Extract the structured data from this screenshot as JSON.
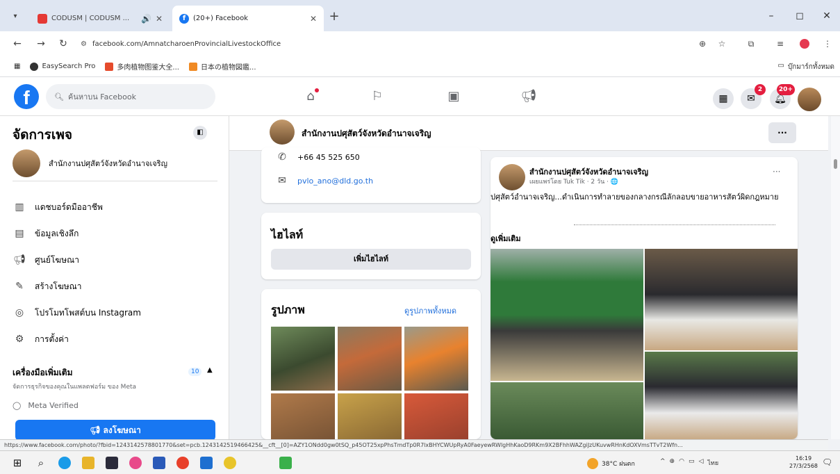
{
  "browser": {
    "tabs": [
      {
        "title": "CODUSM | CODUSM ...",
        "active": false
      },
      {
        "title": "(20+) Facebook",
        "active": true
      }
    ],
    "url": "facebook.com/AmnatcharoenProvincialLivestockOffice",
    "bookmarks": [
      "EasySearch Pro",
      "多肉植物图鉴大全...",
      "日本の植物図鑑..."
    ],
    "bookmarks_right": "บุ๊กมาร์กทั้งหมด",
    "window_controls": {
      "minimize": "–",
      "maximize": "◻",
      "close": "✕"
    }
  },
  "fb_top": {
    "logo": "f",
    "search_placeholder": "ค้นหาบน Facebook",
    "messenger_badge": "2",
    "notifications_badge": "20+"
  },
  "sidebar": {
    "title": "จัดการเพจ",
    "page_name": "สำนักงานปศุสัตว์จังหวัดอำนาจเจริญ",
    "menu": [
      {
        "icon": "dashboard-icon",
        "label": "แดชบอร์ดมืออาชีพ"
      },
      {
        "icon": "insights-icon",
        "label": "ข้อมูลเชิงลึก"
      },
      {
        "icon": "ad-center-icon",
        "label": "ศูนย์โฆษณา"
      },
      {
        "icon": "create-ad-icon",
        "label": "สร้างโฆษณา"
      },
      {
        "icon": "instagram-icon",
        "label": "โปรโมทโพสต์บน Instagram"
      },
      {
        "icon": "settings-icon",
        "label": "การตั้งค่า"
      }
    ],
    "tools_title": "เครื่องมือเพิ่มเติม",
    "tools_subtitle": "จัดการธุรกิจของคุณในแพลตฟอร์ม ของ Meta",
    "tools_count": "10",
    "meta_verified": "Meta Verified",
    "ad_button": "ลงโฆษณา"
  },
  "page_header": {
    "name": "สำนักงานปศุสัตว์จังหวัดอำนาจเจริญ",
    "more": "···"
  },
  "contact": {
    "phone": "+66 45 525 650",
    "email": "pvlo_ano@dld.go.th"
  },
  "featured": {
    "title": "ไฮไลท์",
    "button": "เพิ่มไฮไลท์"
  },
  "photos": {
    "title": "รูปภาพ",
    "see_all": "ดูรูปภาพทั้งหมด"
  },
  "post": {
    "author": "สำนักงานปศุสัตว์จังหวัดอำนาจเจริญ",
    "meta": "เผยแพร่โดย Tuk Tik · 2 วัน · 🌐",
    "more": "···",
    "text": "ปศุสัตว์อำนาจเจริญ...ดำเนินการทำลายของกลางกรณีลักลอบขายอาหารสัตว์ผิดกฎหมาย",
    "see_more": "ดูเพิ่มเติม"
  },
  "status_url": "https://www.facebook.com/photo/?fbid=1243142578801770&set=pcb.1243142519466425&__cft__[0]=AZY1ONdd0gw0tSQ_p45OT25xpPhsTmdTp0R7lxBHYCWUpRyA0FaeyewRWlgHhKaoD9RKm9X2BFhhWAZgiJzUKuvwRHnKdOXVmsTTvT2Wfn...",
  "taskbar": {
    "weather": "38°C ฝนตก",
    "clock_time": "16:19",
    "clock_date": "27/3/2568",
    "lang": "ไทย"
  },
  "colors": {
    "fb_blue": "#1877f2",
    "badge_red": "#e41e3f",
    "page_bg": "#f0f2f5"
  }
}
